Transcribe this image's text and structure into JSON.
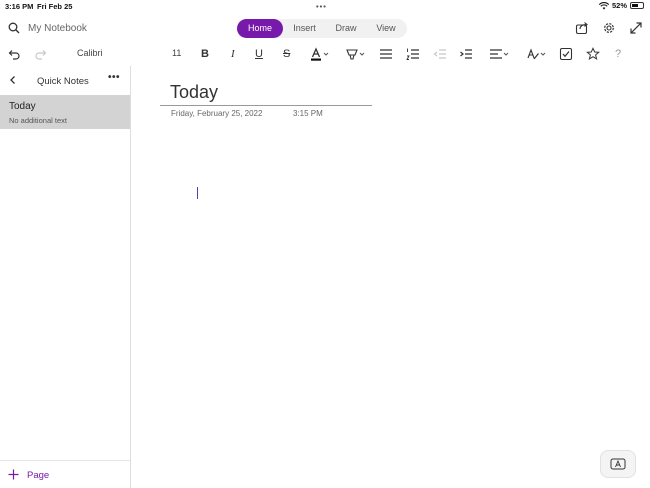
{
  "status_bar": {
    "time": "3:16 PM",
    "date": "Fri Feb 25",
    "more": "•••",
    "battery": "52%"
  },
  "header": {
    "notebook": "My Notebook",
    "tabs": [
      {
        "label": "Home"
      },
      {
        "label": "Insert"
      },
      {
        "label": "Draw"
      },
      {
        "label": "View"
      }
    ]
  },
  "toolbar": {
    "font_name": "Calibri",
    "font_size": "11",
    "bold": "B",
    "italic": "I",
    "underline": "U",
    "strike": "S",
    "help": "?"
  },
  "sidebar": {
    "title": "Quick Notes",
    "more": "•••",
    "pages": [
      {
        "title": "Today",
        "subtitle": "No additional text"
      }
    ],
    "add_page_label": "Page"
  },
  "note": {
    "title": "Today",
    "date": "Friday, February 25, 2022",
    "time": "3:15 PM"
  },
  "colors": {
    "accent": "#7719aa",
    "selected_page": "#d3d3d3"
  }
}
